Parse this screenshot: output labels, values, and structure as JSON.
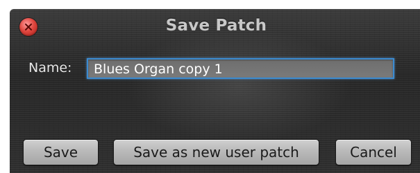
{
  "dialog": {
    "title": "Save Patch",
    "close_icon": "close-x-icon"
  },
  "form": {
    "name_label": "Name:",
    "name_value": "Blues Organ copy 1"
  },
  "buttons": {
    "save_label": "Save",
    "save_new_label": "Save as new user patch",
    "cancel_label": "Cancel"
  },
  "colors": {
    "focus_ring": "#3b8bd0",
    "close_button": "#e0473f"
  }
}
